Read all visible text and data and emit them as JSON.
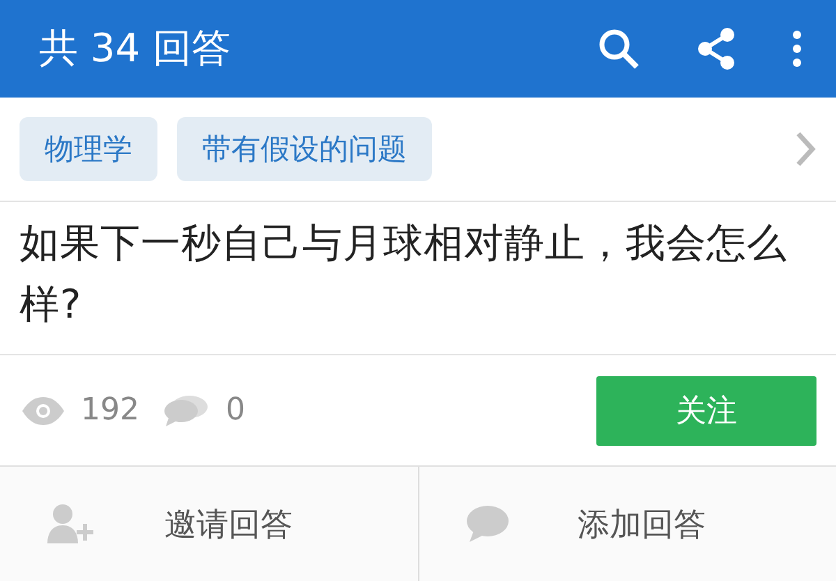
{
  "header": {
    "title": "共 34 回答"
  },
  "tags": [
    "物理学",
    "带有假设的问题"
  ],
  "question": "如果下一秒自己与月球相对静止，我会怎么样?",
  "stats": {
    "views": "192",
    "comments": "0"
  },
  "follow_button": "关注",
  "actions": [
    {
      "kind": "invite",
      "label": "邀请回答"
    },
    {
      "kind": "answer",
      "label": "添加回答"
    }
  ]
}
